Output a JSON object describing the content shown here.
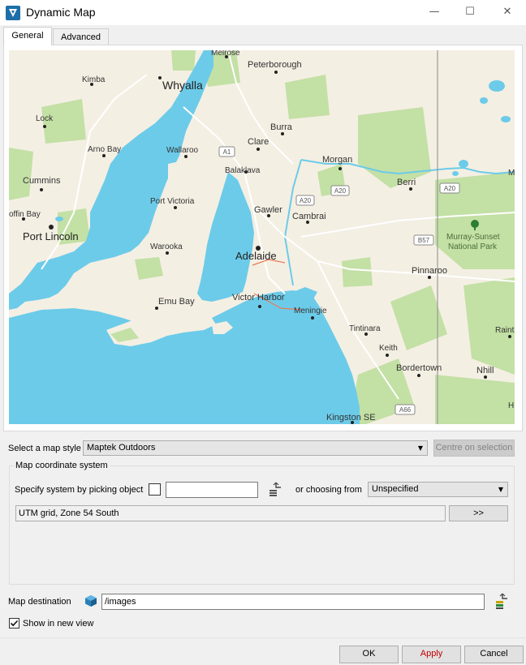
{
  "window": {
    "title": "Dynamic Map",
    "minimize": "—",
    "maximize": "☐",
    "close": "✕"
  },
  "tabs": [
    {
      "label": "General"
    },
    {
      "label": "Advanced"
    }
  ],
  "map": {
    "colors": {
      "water": "#6ccbe9",
      "land": "#f4efe3",
      "park": "#c3e0a5",
      "road": "#ffffff"
    },
    "places": [
      "Melrose",
      "Peterborough",
      "Kimba",
      "Whyalla",
      "Lock",
      "Burra",
      "Arno Bay",
      "Wallaroo",
      "Clare",
      "Morgan",
      "Cummins",
      "Balaklava",
      "Berri",
      "Port Victoria",
      "Gawler",
      "Cambrai",
      "offin Bay",
      "Port Lincoln",
      "Murray-Sunset",
      "National Park",
      "Warooka",
      "Adelaide",
      "Pinnaroo",
      "Emu Bay",
      "Victor Harbor",
      "Meningie",
      "Tintinara",
      "Raint",
      "Keith",
      "Bordertown",
      "Nhill",
      "Kingston SE",
      "M",
      "H"
    ],
    "shields": [
      "A1",
      "A20",
      "A20",
      "A20",
      "B57",
      "A66"
    ]
  },
  "controls": {
    "map_style_label": "Select a map style",
    "map_style_value": "Maptek Outdoors",
    "centre_button": "Centre on selection",
    "coord_group_title": "Map coordinate system",
    "pick_label": "Specify system by picking object",
    "pick_value": "",
    "or_choosing_label": "or choosing from",
    "choosing_value": "Unspecified",
    "grid_value": "UTM grid, Zone 54 South",
    "expand_button": ">>",
    "destination_label": "Map destination",
    "destination_value": "/images",
    "show_new_view_label": "Show in new view",
    "show_new_view_checked": true
  },
  "footer": {
    "ok": "OK",
    "apply": "Apply",
    "cancel": "Cancel",
    "apply_color": "#c00000"
  },
  "icons": [
    "app-icon",
    "pick-object-icon",
    "cube-icon",
    "browse-folder-icon",
    "check-icon",
    "caret-down-icon"
  ]
}
